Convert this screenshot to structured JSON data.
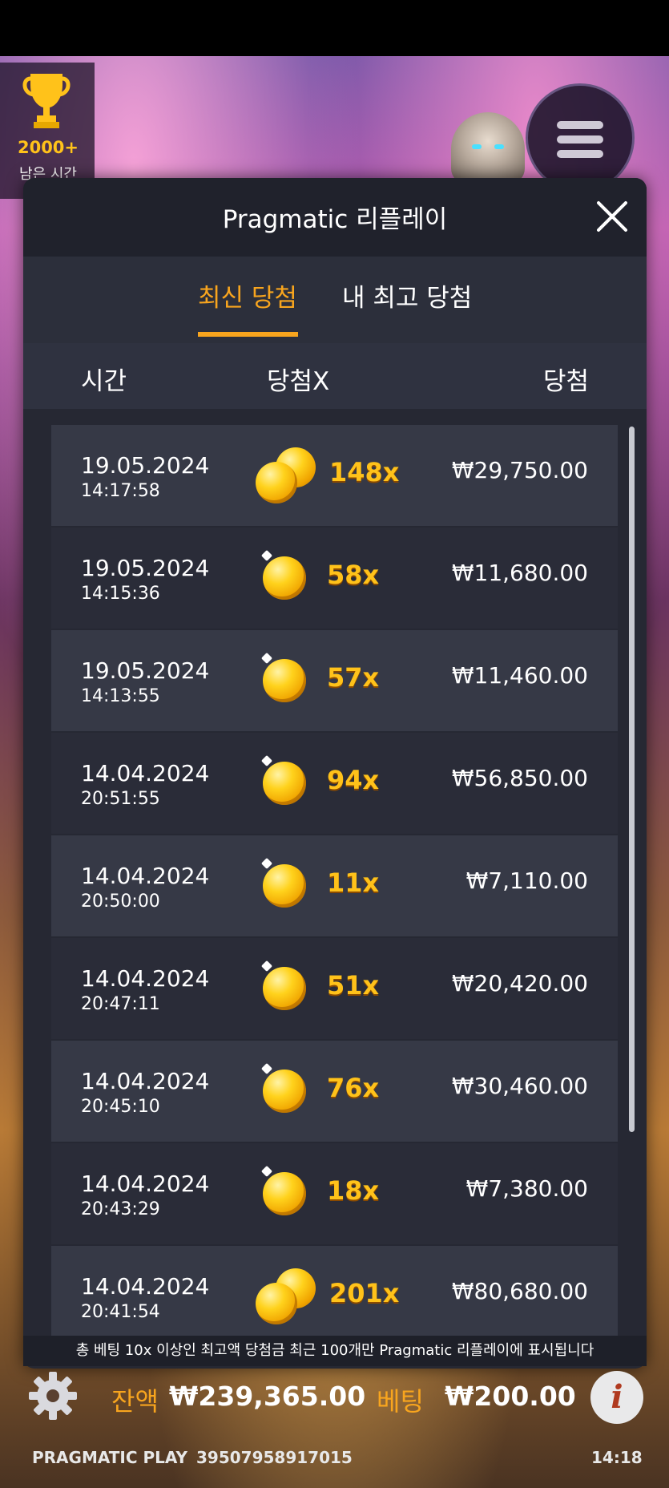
{
  "hud": {
    "trophy_count": "2000+",
    "time_left_label": "남은 시간"
  },
  "modal": {
    "title": "Pragmatic 리플레이",
    "tabs": [
      {
        "label": "최신 당첨",
        "active": true
      },
      {
        "label": "내 최고 당첨",
        "active": false
      }
    ],
    "columns": {
      "time": "시간",
      "multiplier": "당첨X",
      "win": "당첨"
    },
    "rows": [
      {
        "date": "19.05.2024",
        "time": "14:17:58",
        "multiplier": "148x",
        "win": "₩29,750.00",
        "coins": 2
      },
      {
        "date": "19.05.2024",
        "time": "14:15:36",
        "multiplier": "58x",
        "win": "₩11,680.00",
        "coins": 1
      },
      {
        "date": "19.05.2024",
        "time": "14:13:55",
        "multiplier": "57x",
        "win": "₩11,460.00",
        "coins": 1
      },
      {
        "date": "14.04.2024",
        "time": "20:51:55",
        "multiplier": "94x",
        "win": "₩56,850.00",
        "coins": 1
      },
      {
        "date": "14.04.2024",
        "time": "20:50:00",
        "multiplier": "11x",
        "win": "₩7,110.00",
        "coins": 1
      },
      {
        "date": "14.04.2024",
        "time": "20:47:11",
        "multiplier": "51x",
        "win": "₩20,420.00",
        "coins": 1
      },
      {
        "date": "14.04.2024",
        "time": "20:45:10",
        "multiplier": "76x",
        "win": "₩30,460.00",
        "coins": 1
      },
      {
        "date": "14.04.2024",
        "time": "20:43:29",
        "multiplier": "18x",
        "win": "₩7,380.00",
        "coins": 1
      },
      {
        "date": "14.04.2024",
        "time": "20:41:54",
        "multiplier": "201x",
        "win": "₩80,680.00",
        "coins": 2
      }
    ],
    "footer_note": "총 베팅 10x 이상인 최고액 당첨금 최근 100개만 Pragmatic 리플레이에 표시됩니다"
  },
  "bottom": {
    "balance_label": "잔액",
    "balance_value": "₩239,365.00",
    "bet_label": "베팅",
    "bet_value": "₩200.00",
    "brand": "PRAGMATIC PLAY",
    "game_id": "39507958917015",
    "clock": "14:18"
  },
  "colors": {
    "accent": "#f8a51e",
    "modal_bg": "#262833",
    "row_light": "#363946",
    "row_dark": "#2a2c38"
  }
}
